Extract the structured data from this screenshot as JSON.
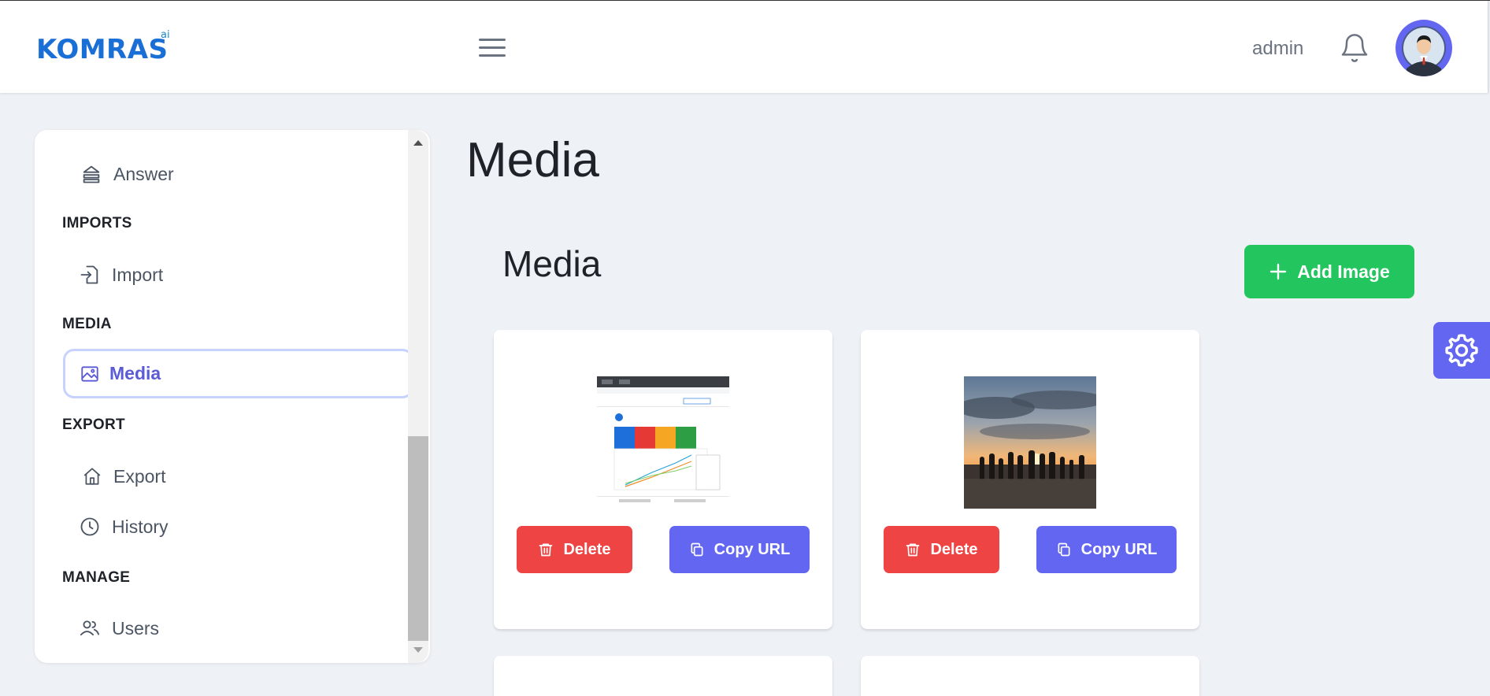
{
  "header": {
    "logo_text": "KOMRAS",
    "logo_sup": "ai",
    "username": "admin"
  },
  "sidebar": {
    "items": [
      {
        "label": "Answer",
        "icon": "layers-icon"
      },
      {
        "label": "Import",
        "icon": "import-icon"
      },
      {
        "label": "Media",
        "icon": "image-icon",
        "active": true
      },
      {
        "label": "Export",
        "icon": "home-icon"
      },
      {
        "label": "History",
        "icon": "clock-icon"
      },
      {
        "label": "Users",
        "icon": "users-icon"
      }
    ],
    "sections": {
      "imports": "IMPORTS",
      "media": "MEDIA",
      "export": "EXPORT",
      "manage": "MANAGE"
    }
  },
  "main": {
    "page_title": "Media",
    "section_title": "Media",
    "add_button_label": "Add Image",
    "cards": [
      {
        "delete_label": "Delete",
        "copy_label": "Copy URL"
      },
      {
        "delete_label": "Delete",
        "copy_label": "Copy URL"
      }
    ]
  },
  "colors": {
    "accent": "#6366f1",
    "success": "#22c55e",
    "danger": "#ef4444",
    "background": "#eef1f5"
  }
}
